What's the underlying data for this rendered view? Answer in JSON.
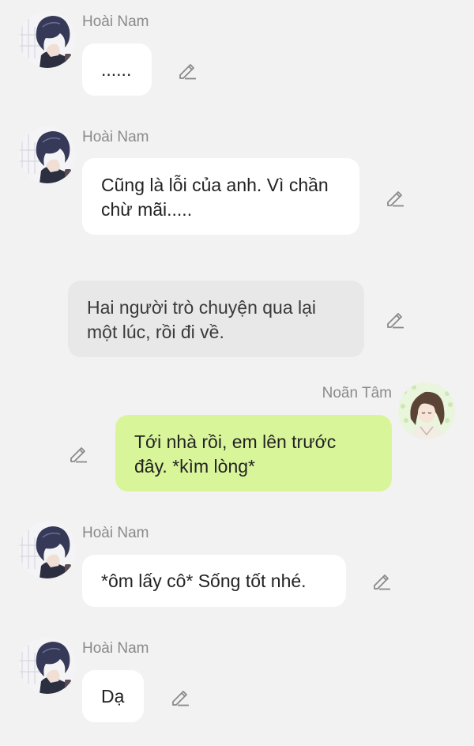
{
  "messages": [
    {
      "sender": "Hoài Nam",
      "text": "......",
      "side": "left"
    },
    {
      "sender": "Hoài Nam",
      "text": "Cũng là lỗi của anh. Vì chần chừ mãi.....",
      "side": "left"
    },
    {
      "sender": "",
      "text": "Hai người trò chuyện qua lại một lúc, rồi đi về.",
      "side": "narration"
    },
    {
      "sender": "Noãn Tâm",
      "text": "Tới nhà rồi, em lên trước đây. *kìm lòng*",
      "side": "right"
    },
    {
      "sender": "Hoài Nam",
      "text": "*ôm lấy cô* Sống tốt nhé.",
      "side": "left"
    },
    {
      "sender": "Hoài Nam",
      "text": "Dạ",
      "side": "left"
    }
  ],
  "icons": {
    "edit": "pencil-edit-icon",
    "avatar_left": "avatar-hoai-nam",
    "avatar_right": "avatar-noan-tam"
  },
  "colors": {
    "background": "#f2f2f2",
    "bubble_incoming": "#ffffff",
    "bubble_narration": "#e8e8e8",
    "bubble_outgoing": "#d9f59a",
    "name_text": "#8a8a8a"
  }
}
